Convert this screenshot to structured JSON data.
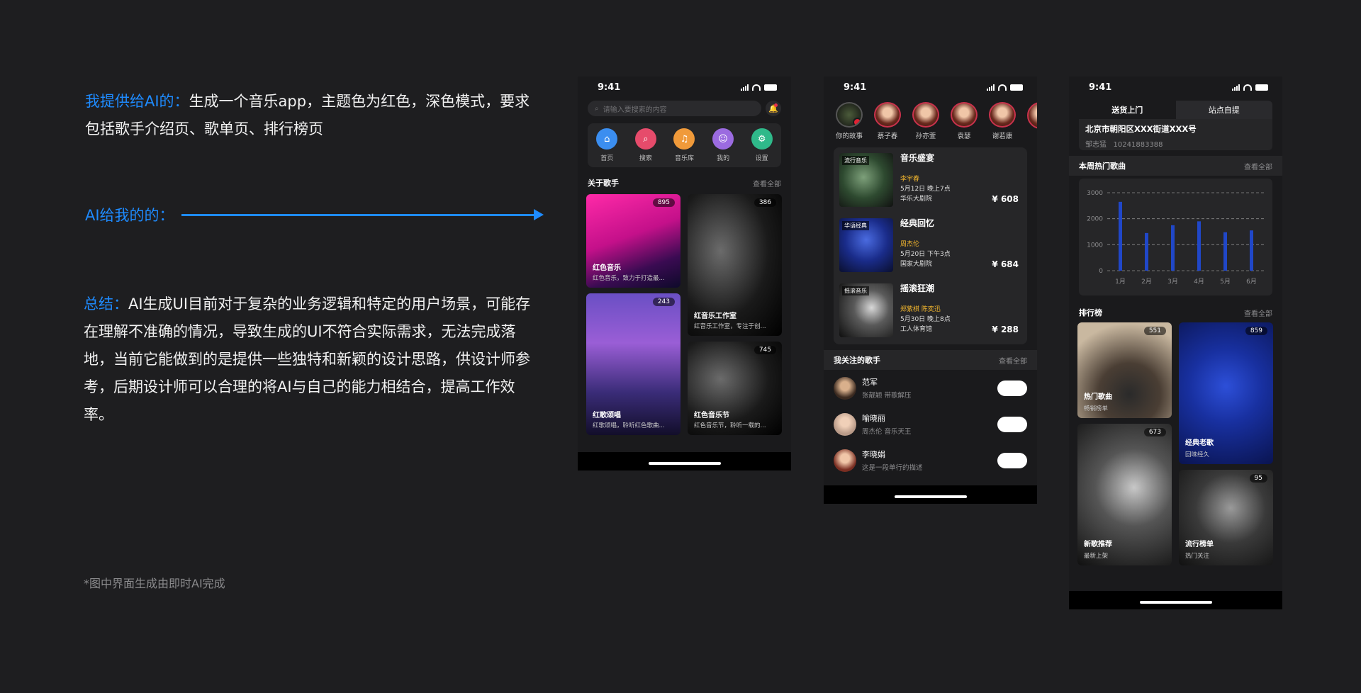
{
  "left": {
    "intro_prefix": "我提供给AI的：",
    "intro_text": "生成一个音乐app，主题色为红色，深色模式，要求包括歌手介绍页、歌单页、排行榜页",
    "arrow_label": "AI给我的的：",
    "summary_prefix": "总结：",
    "summary_text": "AI生成UI目前对于复杂的业务逻辑和特定的用户场景，可能存在理解不准确的情况，导致生成的UI不符合实际需求，无法完成落地，当前它能做到的是提供一些独特和新颖的设计思路，供设计师参考，后期设计师可以合理的将AI与自己的能力相结合，提高工作效率。",
    "footnote": "*图中界面生成由即时AI完成"
  },
  "status_time": "9:41",
  "accent": "#1e8bff",
  "phone1": {
    "search_placeholder": "请输入要搜索的内容",
    "nav": [
      {
        "label": "首页",
        "icon": "home-icon",
        "color": "#3b8ef0"
      },
      {
        "label": "搜索",
        "icon": "search-icon",
        "color": "#e64b6b"
      },
      {
        "label": "音乐库",
        "icon": "music-note-icon",
        "color": "#f09a3a"
      },
      {
        "label": "我的",
        "icon": "user-icon",
        "color": "#9b6be0"
      },
      {
        "label": "设置",
        "icon": "gear-icon",
        "color": "#2fb98a"
      }
    ],
    "section_title": "关于歌手",
    "section_more": "查看全部",
    "tiles": [
      {
        "title": "红色音乐",
        "subtitle": "红色音乐，致力于打造最...",
        "count": "895"
      },
      {
        "title": "红音乐工作室",
        "subtitle": "红音乐工作室，专注于创...",
        "count": "386"
      },
      {
        "title": "红歌颂唱",
        "subtitle": "红歌颂唱，聆听红色歌曲...",
        "count": "243"
      },
      {
        "title": "红色音乐节",
        "subtitle": "红色音乐节，聆听一载的...",
        "count": "745"
      }
    ]
  },
  "phone2": {
    "stories": [
      {
        "name": "你的故事"
      },
      {
        "name": "蔡子春"
      },
      {
        "name": "孙亦萱"
      },
      {
        "name": "袁瑟"
      },
      {
        "name": "谢若康"
      },
      {
        "name": "i"
      }
    ],
    "concerts": [
      {
        "title": "音乐盛宴",
        "tag": "流行音乐",
        "artist": "李宇春",
        "date": "5月12日 晚上7点",
        "venue": "华乐大剧院",
        "price": "¥ 608"
      },
      {
        "title": "经典回忆",
        "tag": "华语经典",
        "artist": "周杰伦",
        "date": "5月20日 下午3点",
        "venue": "国家大剧院",
        "price": "¥ 684"
      },
      {
        "title": "摇滚狂潮",
        "tag": "摇滚音乐",
        "artist": "郑紫棋 陈奕迅",
        "date": "5月30日 晚上8点",
        "venue": "工人体育馆",
        "price": "¥ 288"
      }
    ],
    "follow_title": "我关注的歌手",
    "follow_more": "查看全部",
    "follows": [
      {
        "name": "范军",
        "desc": "张靓颖 带歌解压"
      },
      {
        "name": "喻晓丽",
        "desc": "周杰伦 音乐天王"
      },
      {
        "name": "李晓娟",
        "desc": "这是一段单行的描述"
      }
    ]
  },
  "phone3": {
    "tabs": [
      "送货上门",
      "站点自提"
    ],
    "address": "北京市朝阳区XXX街道XXX号",
    "contact_name": "邹志猛",
    "contact_phone": "10241883388",
    "chart_title": "本周热门歌曲",
    "chart_more": "查看全部",
    "rank_title": "排行榜",
    "rank_more": "查看全部",
    "rank_tiles": [
      {
        "title": "热门歌曲",
        "subtitle": "畅销榜单",
        "count": "551"
      },
      {
        "title": "经典老歌",
        "subtitle": "回味经久",
        "count": "859"
      },
      {
        "title": "新歌推荐",
        "subtitle": "最新上架",
        "count": "673"
      },
      {
        "title": "流行榜单",
        "subtitle": "热门关注",
        "count": "95"
      }
    ]
  },
  "chart_data": {
    "type": "bar",
    "categories": [
      "1月",
      "2月",
      "3月",
      "4月",
      "5月",
      "6月"
    ],
    "values": [
      2650,
      1450,
      1750,
      1900,
      1480,
      1550
    ],
    "ylim": [
      0,
      3000
    ],
    "yticks": [
      "0",
      "1000",
      "2000",
      "3000"
    ],
    "grid": true,
    "bar_color": "#2047c8"
  }
}
